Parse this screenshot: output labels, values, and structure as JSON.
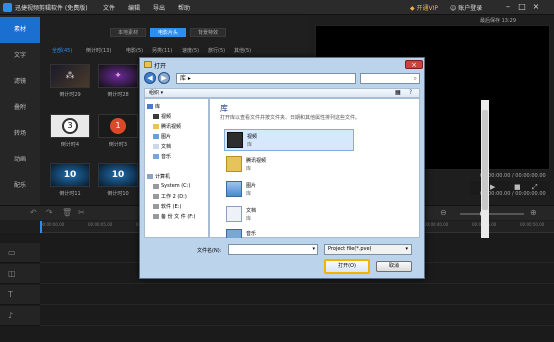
{
  "app": {
    "title": "迅捷视频剪辑软件 (免费版)",
    "menu": [
      "文件",
      "编辑",
      "导出",
      "帮助"
    ],
    "vip_label": "开通VIP",
    "login_label": "账户登录",
    "autosave": "最后保存 13:29"
  },
  "sidebar": {
    "items": [
      {
        "label": "素材",
        "active": true
      },
      {
        "label": "文字",
        "active": false
      },
      {
        "label": "滤镜",
        "active": false
      },
      {
        "label": "叠附",
        "active": false
      },
      {
        "label": "转场",
        "active": false
      },
      {
        "label": "动画",
        "active": false
      },
      {
        "label": "配乐",
        "active": false
      }
    ]
  },
  "media": {
    "subtabs": [
      "本地素材",
      "电影片头",
      "背景特效"
    ],
    "active_subtab": 1,
    "categories": [
      "全部(45)",
      "倒计时(13)",
      "电影(5)",
      "另类(11)",
      "速度(5)",
      "旅行(5)",
      "其他(5)"
    ],
    "thumbs": [
      {
        "label": "倒计时29",
        "glyph": "⁂"
      },
      {
        "label": "倒计时28",
        "glyph": "✦"
      },
      {
        "label": "倒计时4",
        "glyph": "3"
      },
      {
        "label": "倒计时3",
        "glyph": "1"
      },
      {
        "label": "倒计时11",
        "glyph": "10"
      },
      {
        "label": "倒计时10",
        "glyph": "10"
      }
    ]
  },
  "preview": {
    "timecode_top": "00:00:00.00 / 00:00:00.00",
    "timecode_bottom": "00:00:00.00 / 00:00:00.00"
  },
  "timeline": {
    "ticks": [
      "00:00:00.00",
      "00:00:05.00",
      "00:00:10.00",
      "00:00:15.00",
      "00:00:20.00",
      "00:00:25.00",
      "00:00:30.00",
      "00:00:35.00",
      "00:00:40.00",
      "00:00:45.00",
      "00:00:50.00"
    ]
  },
  "dialog": {
    "title": "打开",
    "address": "库",
    "organize": "组织 ▾",
    "nav": {
      "library": "库",
      "items": [
        "视频",
        "腾讯视频",
        "图片",
        "文档",
        "音乐"
      ],
      "computer": "计算机",
      "drives": [
        "System (C:)",
        "工作 2 (D:)",
        "软件 (E:)",
        "备 份 文 件 (F:)"
      ]
    },
    "lib_title": "库",
    "lib_desc": "打开库以查看文件并按文件夹、日期和其他属性排列这些文件。",
    "lib_items": [
      {
        "name": "视频",
        "sub": "库"
      },
      {
        "name": "腾讯视频",
        "sub": "库"
      },
      {
        "name": "图片",
        "sub": "库"
      },
      {
        "name": "文档",
        "sub": "库"
      },
      {
        "name": "音乐",
        "sub": ""
      }
    ],
    "filename_label": "文件名(N):",
    "filetype": "Project file(*.pve)",
    "open_label": "打开(O)",
    "cancel_label": "取消"
  }
}
